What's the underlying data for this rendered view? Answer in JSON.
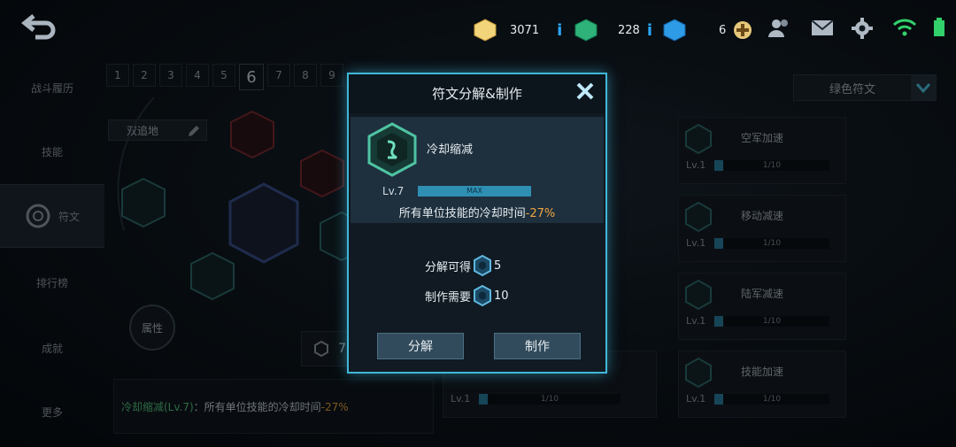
{
  "topbar": {
    "gold": "3071",
    "gems": "228",
    "diamonds": "6"
  },
  "sidebar": {
    "items": [
      {
        "label": "战斗履历"
      },
      {
        "label": "技能"
      },
      {
        "label": "符文"
      },
      {
        "label": "排行榜"
      },
      {
        "label": "成就"
      },
      {
        "label": "更多"
      }
    ]
  },
  "pages": [
    "1",
    "2",
    "3",
    "4",
    "5",
    "6",
    "7",
    "8",
    "9"
  ],
  "preset_name": "双追地",
  "attr_label": "属性",
  "rune_count": "7",
  "description": {
    "name": "冷却缩减(Lv.7)",
    "text": "：所有单位技能的冷却时间",
    "value": "-27%"
  },
  "filter": {
    "label": "绿色符文"
  },
  "cards": [
    {
      "name": "空军加速",
      "lv": "Lv.1",
      "progress": "1/10"
    },
    {
      "name": "移动减速",
      "lv": "Lv.1",
      "progress": "1/10"
    },
    {
      "name": "陆军减速",
      "lv": "Lv.1",
      "progress": "1/10"
    },
    {
      "name": "技能加速",
      "lv": "Lv.1",
      "progress": "1/10"
    }
  ],
  "mid_card": {
    "lv": "Lv.1",
    "progress": "1/10"
  },
  "modal": {
    "title": "符文分解&制作",
    "rune_name": "冷却缩减",
    "level": "Lv.7",
    "level_bar_text": "MAX",
    "effect_text": "所有单位技能的冷却时间",
    "effect_value": "-27%",
    "decompose_label": "分解可得",
    "decompose_value": "5",
    "craft_label": "制作需要",
    "craft_value": "10",
    "decompose_button": "分解",
    "craft_button": "制作"
  },
  "colors": {
    "accent": "#3fb7d8",
    "highlight": "#f0a640",
    "green_text": "#55c27c"
  }
}
